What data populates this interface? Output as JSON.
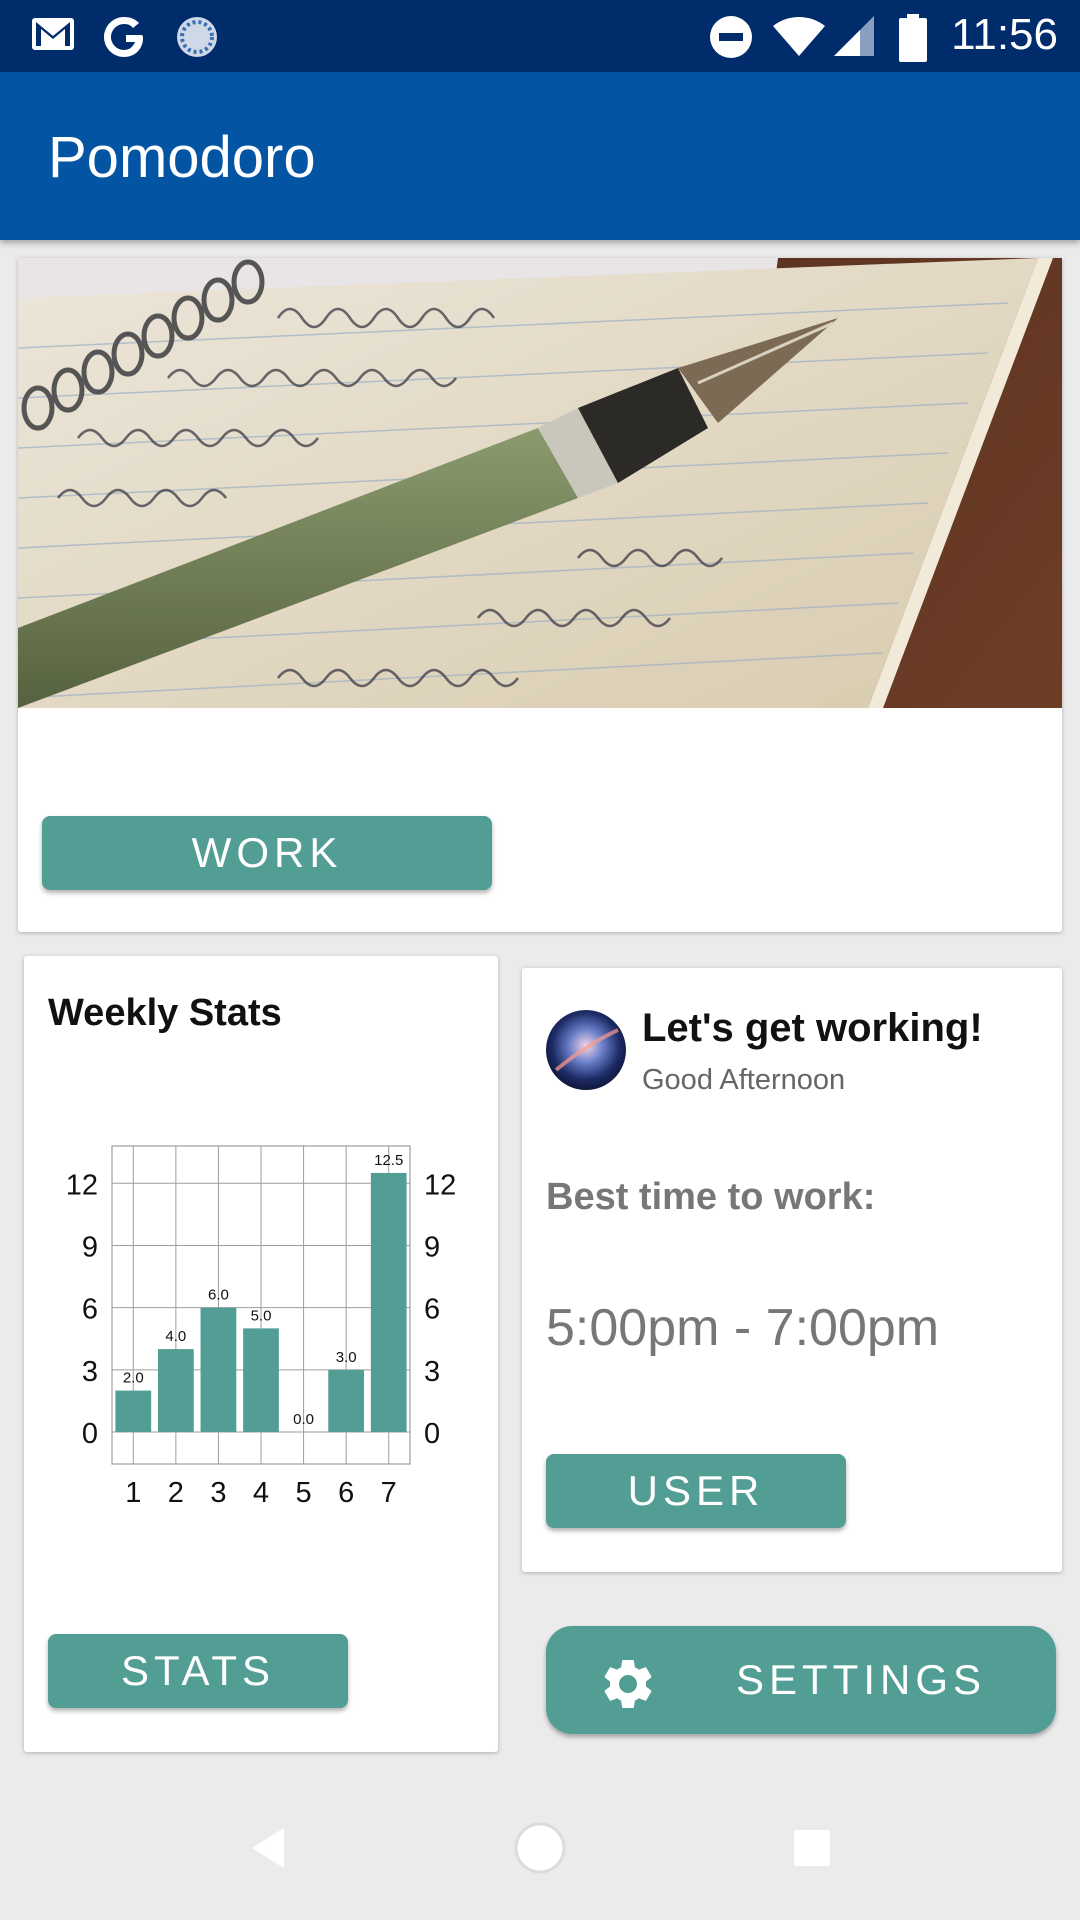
{
  "status_bar": {
    "time": "11:56",
    "icons": [
      "gmail-icon",
      "google-icon",
      "sync-icon",
      "do-not-disturb-icon",
      "wifi-icon",
      "signal-icon",
      "battery-icon"
    ]
  },
  "app_bar": {
    "title": "Pomodoro"
  },
  "work_card": {
    "button_label": "WORK"
  },
  "stats_card": {
    "title": "Weekly Stats",
    "button_label": "STATS"
  },
  "user_card": {
    "greeting_title": "Let's get working!",
    "greeting_subtitle": "Good Afternoon",
    "best_time_label": "Best time to work:",
    "best_time_value": "5:00pm - 7:00pm",
    "button_label": "USER"
  },
  "settings": {
    "button_label": "SETTINGS",
    "icon": "gear-icon"
  },
  "nav_bar": {
    "icons": [
      "back-icon",
      "home-icon",
      "recents-icon"
    ]
  },
  "colors": {
    "status_bar": "#002c6c",
    "app_bar": "#0355a3",
    "accent": "#529e94",
    "background": "#ebebeb"
  },
  "chart_data": {
    "type": "bar",
    "title": "Weekly Stats",
    "categories": [
      "1",
      "2",
      "3",
      "4",
      "5",
      "6",
      "7"
    ],
    "values": [
      2.0,
      4.0,
      6.0,
      5.0,
      0.0,
      3.0,
      12.5
    ],
    "value_labels": [
      "2.0",
      "4.0",
      "6.0",
      "5.0",
      "0.0",
      "3.0",
      "12.5"
    ],
    "y_ticks": [
      "0",
      "3",
      "6",
      "9",
      "12"
    ],
    "ylim": [
      0,
      13.8
    ],
    "grid": true,
    "left_axis": true,
    "right_axis": true,
    "color": "#529e94"
  }
}
